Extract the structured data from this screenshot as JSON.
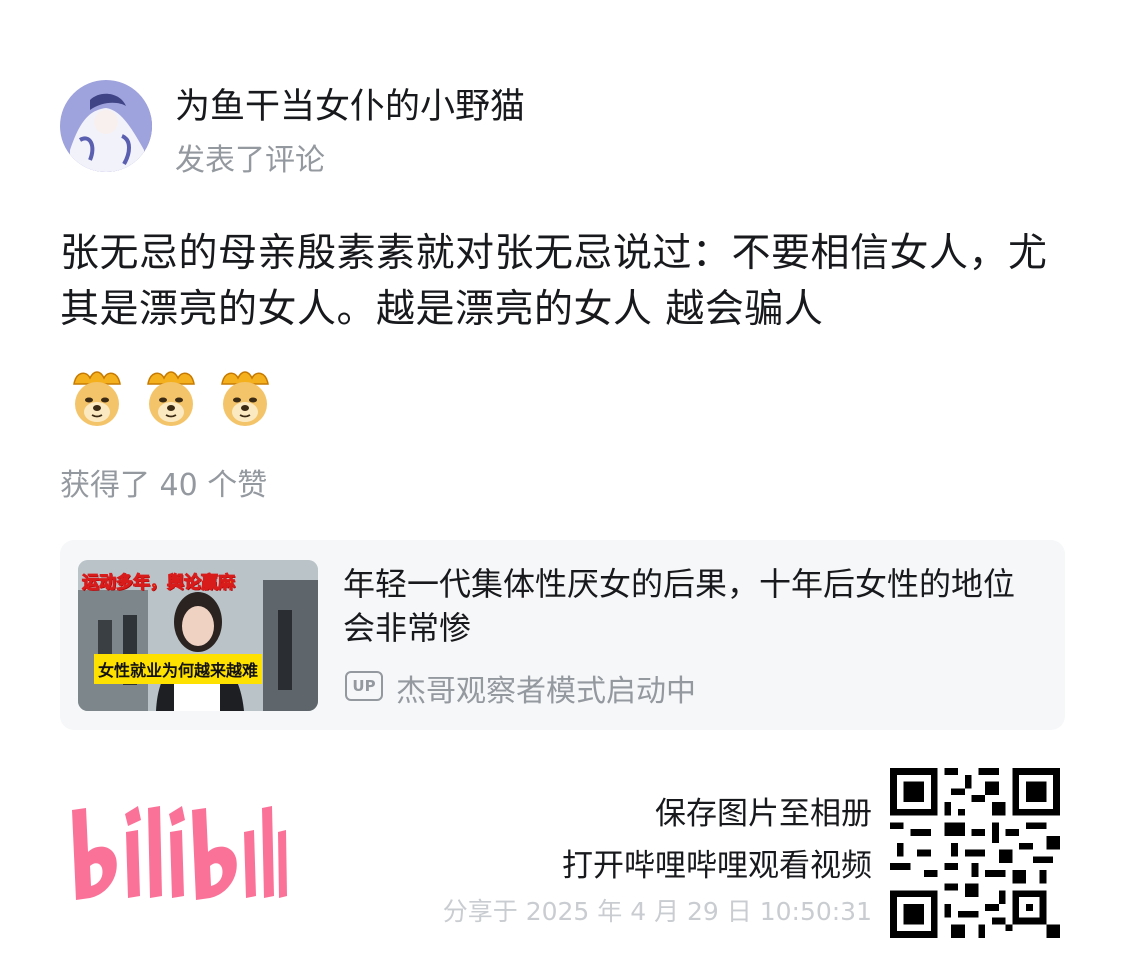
{
  "header": {
    "username": "为鱼干当女仆的小野猫",
    "action": "发表了评论"
  },
  "comment": {
    "text": "张无忌的母亲殷素素就对张无忌说过：不要相信女人，尤其是漂亮的女人。越是漂亮的女人 越会骗人",
    "emojis": [
      "doge-icon",
      "doge-icon",
      "doge-icon"
    ],
    "likes": "获得了 40 个赞"
  },
  "video_card": {
    "thumbnail_caption_top": "运动多年，舆论赢麻",
    "thumbnail_caption_bottom": "女性就业为何越来越难",
    "title": "年轻一代集体性厌女的后果，十年后女性的地位会非常惨",
    "up_badge": "UP",
    "author": "杰哥观察者模式启动中"
  },
  "footer": {
    "logo_text": "bilibili",
    "save_label": "保存图片至相册",
    "open_label": "打开哔哩哔哩观看视频",
    "share_time": "分享于 2025 年 4 月 29 日 10:50:31"
  },
  "colors": {
    "brand_pink": "#fb7299",
    "text_primary": "#18191c",
    "text_secondary": "#9499a0",
    "card_bg": "#f6f7f8"
  }
}
